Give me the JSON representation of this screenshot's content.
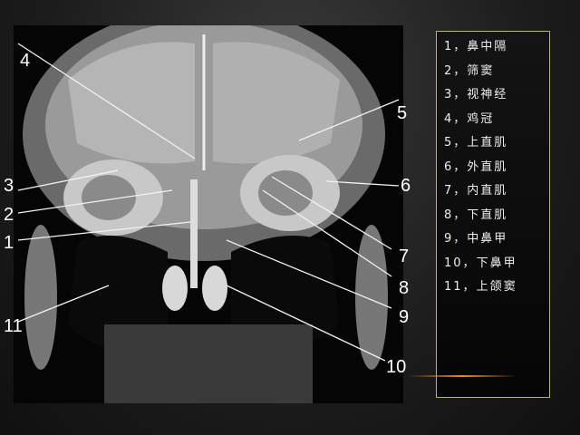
{
  "legend": {
    "items": [
      {
        "num": "1",
        "label": "鼻中隔"
      },
      {
        "num": "2",
        "label": "筛窦"
      },
      {
        "num": "3",
        "label": "视神经"
      },
      {
        "num": "4",
        "label": "鸡冠"
      },
      {
        "num": "5",
        "label": "上直肌"
      },
      {
        "num": "6",
        "label": "外直肌"
      },
      {
        "num": "7",
        "label": "内直肌"
      },
      {
        "num": "8",
        "label": "下直肌"
      },
      {
        "num": "9",
        "label": "中鼻甲"
      },
      {
        "num": "10",
        "label": "下鼻甲"
      },
      {
        "num": "11",
        "label": "上颌窦"
      }
    ]
  },
  "markers": [
    "1",
    "2",
    "3",
    "4",
    "5",
    "6",
    "7",
    "8",
    "9",
    "10",
    "11"
  ]
}
